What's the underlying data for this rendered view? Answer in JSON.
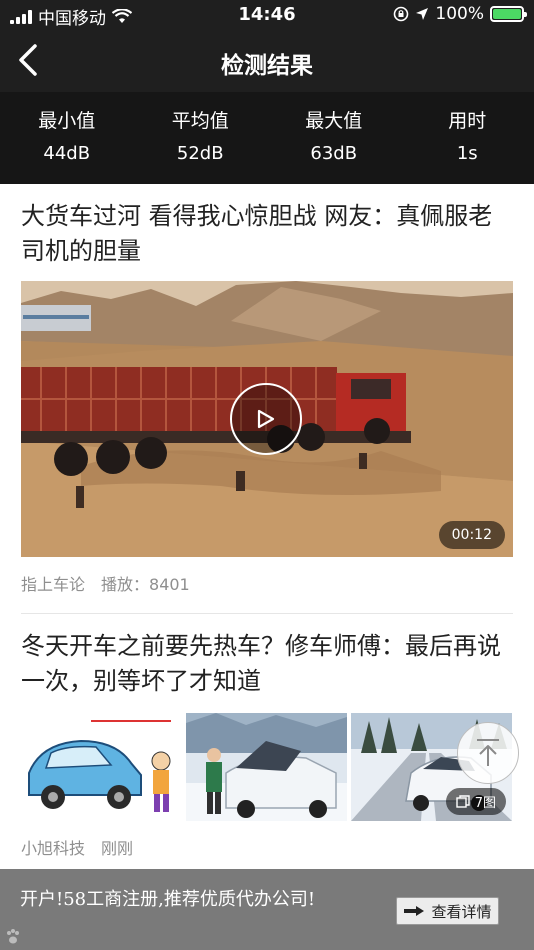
{
  "status_bar": {
    "carrier": "中国移动",
    "time": "14:46",
    "battery": "100%"
  },
  "nav": {
    "title": "检测结果",
    "back_icon": "chevron-left-icon"
  },
  "stats": [
    {
      "label": "最小值",
      "value": "44dB"
    },
    {
      "label": "平均值",
      "value": "52dB"
    },
    {
      "label": "最大值",
      "value": "63dB"
    },
    {
      "label": "用时",
      "value": "1s"
    }
  ],
  "articles": [
    {
      "title": "大货车过河 看得我心惊胆战 网友：真佩服老司机的胆量",
      "duration": "00:12",
      "source": "指上车论",
      "plays": "播放：8401"
    },
    {
      "title": "冬天开车之前要先热车？修车师傅：最后再说一次，别等坏了才知道",
      "image_count": "7图",
      "source": "小旭科技",
      "time": "刚刚"
    }
  ],
  "ad": {
    "text": "开户!58工商注册,推荐优质代办公司!",
    "button_label": "查看详情"
  },
  "colors": {
    "bar": "#1f1f1f",
    "stats_bg": "#161616",
    "battery": "#4cd964",
    "ad_bg": "#7a7a7a"
  }
}
